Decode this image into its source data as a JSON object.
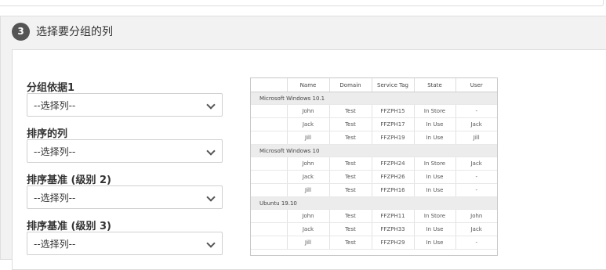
{
  "section": {
    "step": "3",
    "title": "选择要分组的列"
  },
  "fields": [
    {
      "label": "分组依据1",
      "value": "--选择列--"
    },
    {
      "label": "排序的列",
      "value": "--选择列--"
    },
    {
      "label": "排序基准 (级别 2)",
      "value": "--选择列--"
    },
    {
      "label": "排序基准 (级别 3)",
      "value": "--选择列--"
    }
  ],
  "preview": {
    "columns": [
      "Name",
      "Domain",
      "Service Tag",
      "State",
      "User"
    ],
    "groups": [
      {
        "name": "Microsoft Windows 10.1",
        "rows": [
          [
            "John",
            "Test",
            "FFZPH15",
            "In Store",
            "-"
          ],
          [
            "Jack",
            "Test",
            "FFZPH17",
            "In Use",
            "Jack"
          ],
          [
            "Jill",
            "Test",
            "FFZPH19",
            "In Use",
            "Jill"
          ]
        ]
      },
      {
        "name": "Microsoft Windows 10",
        "rows": [
          [
            "John",
            "Test",
            "FFZPH24",
            "In Store",
            "Jack"
          ],
          [
            "Jack",
            "Test",
            "FFZPH26",
            "In Use",
            "-"
          ],
          [
            "Jill",
            "Test",
            "FFZPH16",
            "In Use",
            "-"
          ]
        ]
      },
      {
        "name": "Ubuntu 19.10",
        "rows": [
          [
            "John",
            "Test",
            "FFZPH11",
            "In Store",
            "John"
          ],
          [
            "Jack",
            "Test",
            "FFZPH33",
            "In Use",
            "Jack"
          ],
          [
            "Jill",
            "Test",
            "FFZPH29",
            "In Use",
            "-"
          ]
        ]
      }
    ]
  }
}
